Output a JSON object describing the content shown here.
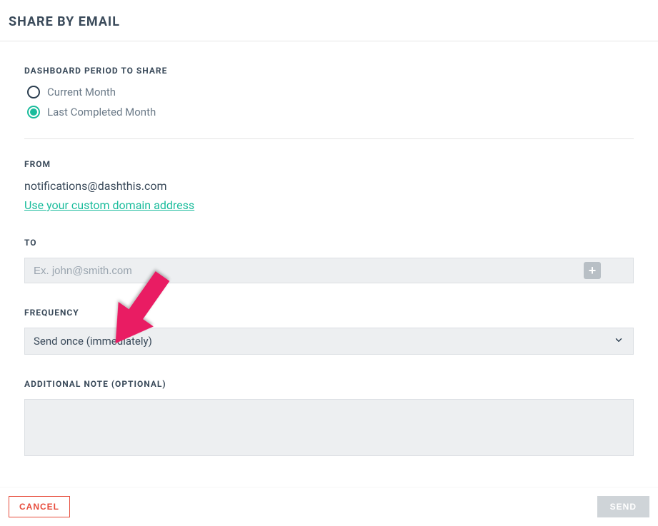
{
  "header": {
    "title": "SHARE BY EMAIL"
  },
  "period": {
    "label": "DASHBOARD PERIOD TO SHARE",
    "options": {
      "current": "Current Month",
      "last": "Last Completed Month"
    }
  },
  "from": {
    "label": "FROM",
    "email": "notifications@dashthis.com",
    "link_text": "Use your custom domain address"
  },
  "to": {
    "label": "TO",
    "placeholder": "Ex. john@smith.com"
  },
  "frequency": {
    "label": "FREQUENCY",
    "value": "Send once (immediately)"
  },
  "note": {
    "label": "ADDITIONAL NOTE (OPTIONAL)"
  },
  "footer": {
    "cancel": "CANCEL",
    "send": "SEND"
  }
}
